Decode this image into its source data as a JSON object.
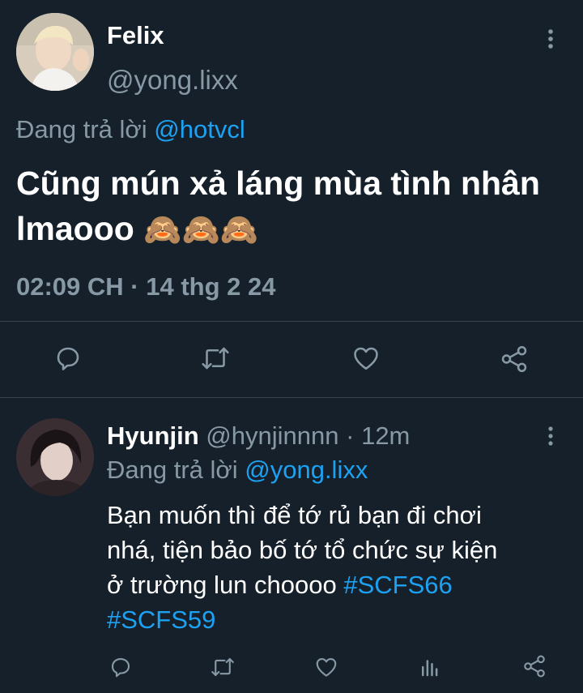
{
  "tweet": {
    "author_name": "Felix",
    "author_handle": "@yong.lixx",
    "replying_prefix": "Đang trả lời",
    "replying_to": "@hotvcl",
    "text_line1": "Cũng mún xả láng mùa tình nhân",
    "text_line2": "lmaooo",
    "emoji": "🙈🙈🙈",
    "timestamp": "02:09 CH · 14 thg 2 24"
  },
  "reply": {
    "author_name": "Hyunjin",
    "author_handle": "@hynjinnnn",
    "separator": "·",
    "time_ago": "12m",
    "replying_prefix": "Đang trả lời",
    "replying_to": "@yong.lixx",
    "text_line1": "Bạn muốn thì để tớ rủ bạn đi chơi",
    "text_line2": "nhá, tiện bảo bố tớ tổ chức sự kiện",
    "text_line3": "ở trường lun choooo",
    "hashtag1": "#SCFS66",
    "hashtag2": "#SCFS59"
  },
  "icons": {
    "more": "more-vertical-icon",
    "reply": "reply-icon",
    "retweet": "retweet-icon",
    "like": "heart-icon",
    "share": "share-icon",
    "analytics": "analytics-icon"
  },
  "colors": {
    "background": "#15202b",
    "muted": "#8899a6",
    "link": "#1da1f2",
    "divider": "#38444d"
  }
}
